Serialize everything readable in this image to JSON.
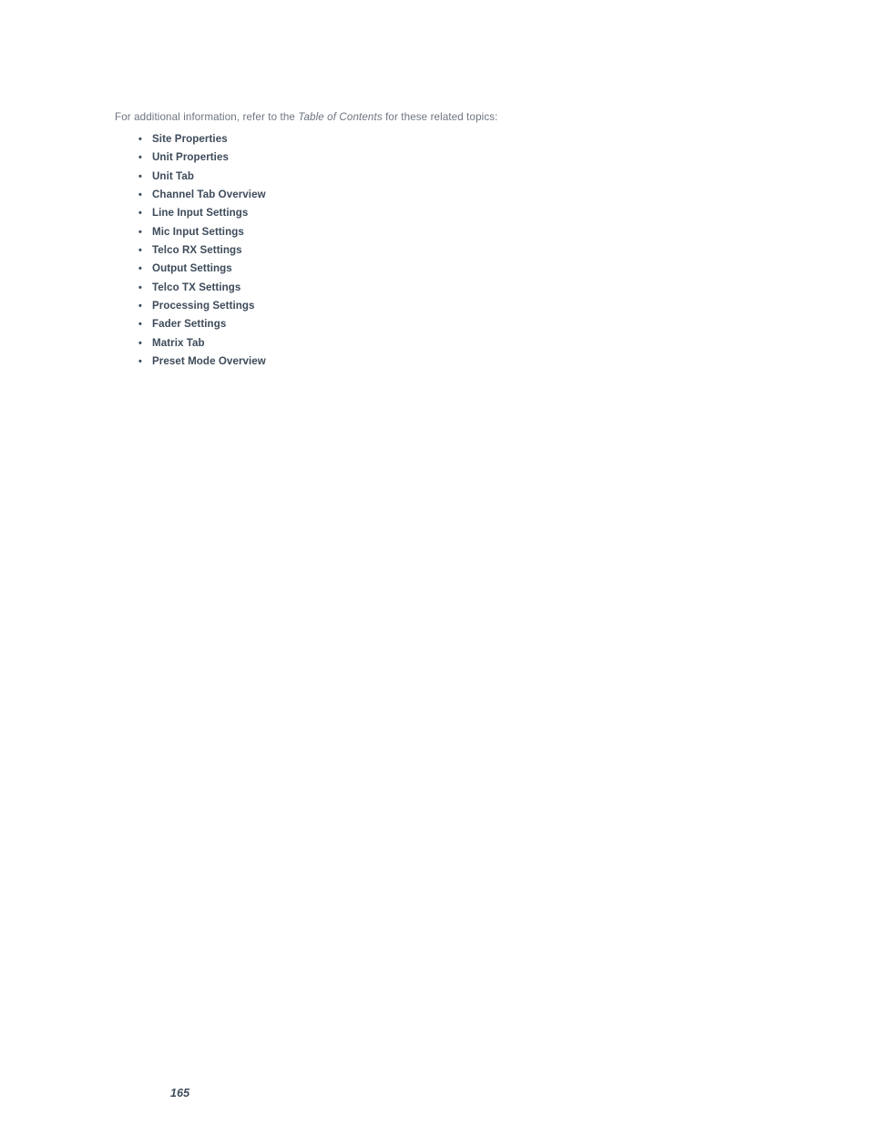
{
  "document": {
    "page_number": "165",
    "intro": {
      "before_emphasis": "For additional information, refer to the ",
      "emphasis": "Table of Contents",
      "after_emphasis": " for these related topics:"
    },
    "bullet_glyph": "•",
    "colors": {
      "heading_text": "#3d4b5a",
      "body_text": "#6d7580",
      "page_background": "#ffffff"
    },
    "related_topics": [
      {
        "label": "Site Properties"
      },
      {
        "label": "Unit Properties"
      },
      {
        "label": "Unit Tab"
      },
      {
        "label": "Channel Tab Overview"
      },
      {
        "label": "Line Input Settings"
      },
      {
        "label": "Mic Input Settings"
      },
      {
        "label": "Telco RX Settings"
      },
      {
        "label": "Output Settings"
      },
      {
        "label": "Telco TX Settings"
      },
      {
        "label": "Processing Settings"
      },
      {
        "label": "Fader Settings"
      },
      {
        "label": "Matrix Tab"
      },
      {
        "label": "Preset Mode Overview"
      }
    ]
  }
}
